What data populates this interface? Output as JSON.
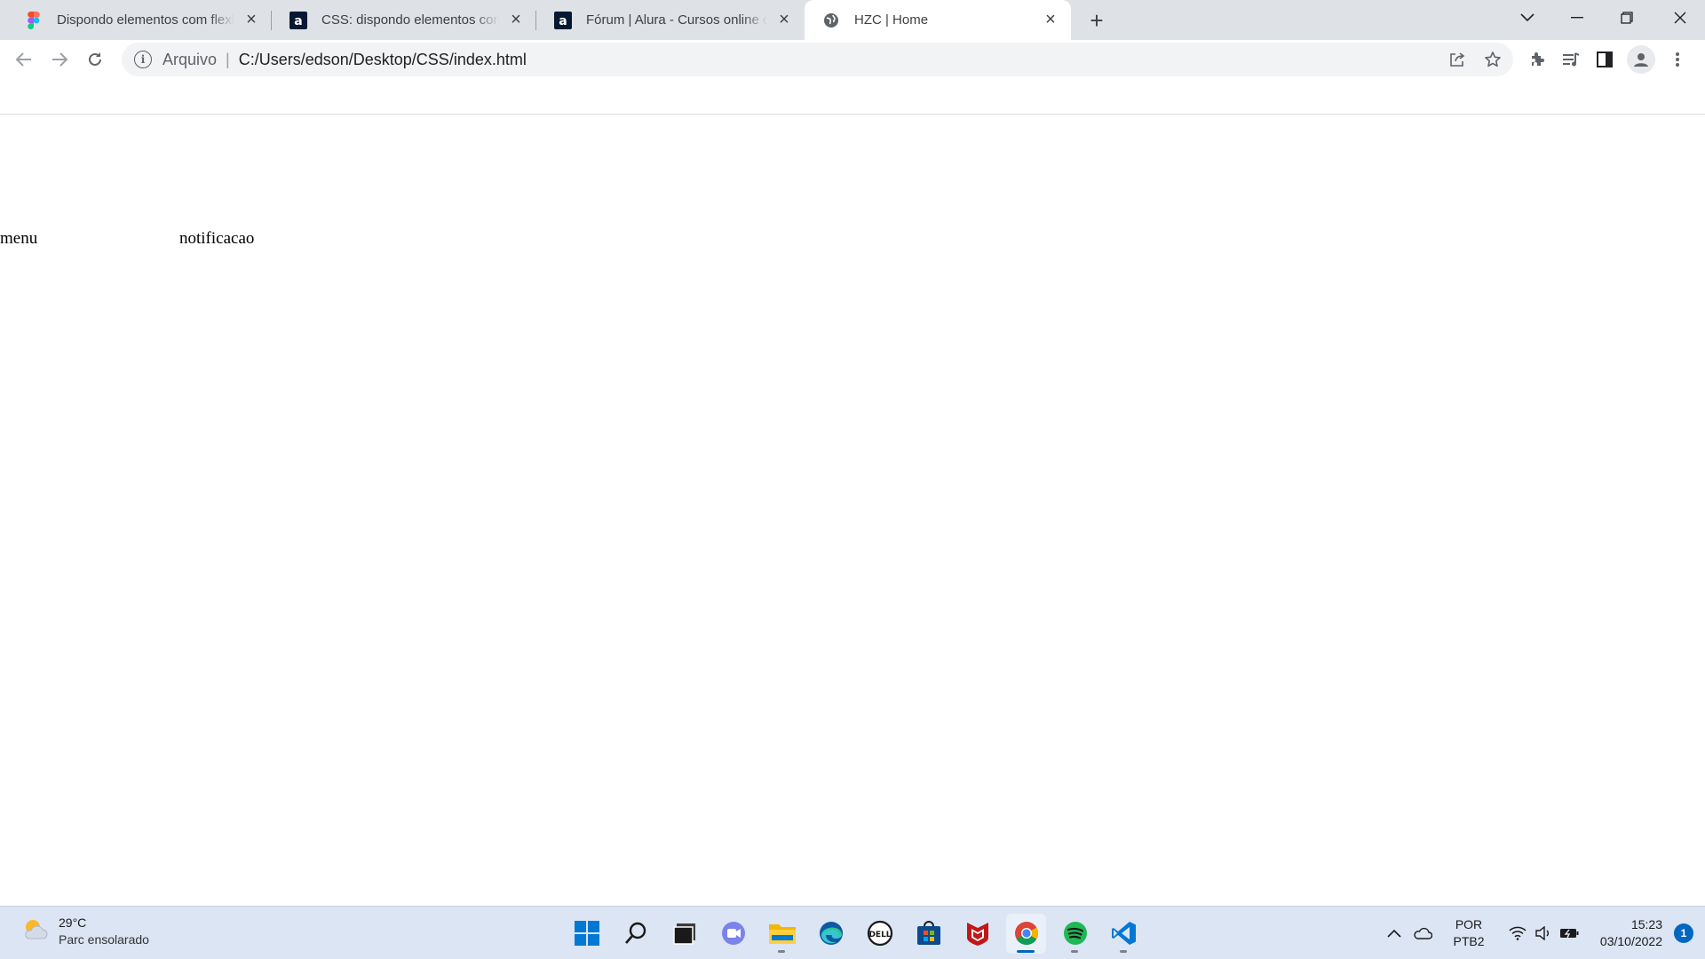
{
  "browser": {
    "tabs": [
      {
        "title": "Dispondo elementos com flexbox",
        "favicon": "figma-icon",
        "active": false
      },
      {
        "title": "CSS: dispondo elementos com Flexbox",
        "favicon": "alura-icon",
        "active": false
      },
      {
        "title": "Fórum | Alura - Cursos online de tecnologia",
        "favicon": "alura-icon",
        "active": false
      },
      {
        "title": "HZC | Home",
        "favicon": "globe-icon",
        "active": true
      }
    ],
    "address": {
      "scheme_label": "Arquivo",
      "separator": "|",
      "url": "C:/Users/edson/Desktop/CSS/index.html"
    }
  },
  "page": {
    "items": [
      "menu",
      "notificacao"
    ]
  },
  "taskbar": {
    "weather": {
      "temp": "29°C",
      "condition": "Parc ensolarado"
    },
    "apps": [
      "windows-start",
      "search",
      "task-view",
      "teams-chat",
      "file-explorer",
      "edge",
      "dell",
      "microsoft-store",
      "mcafee",
      "chrome",
      "spotify",
      "vscode"
    ],
    "tray": {
      "lang_line1": "POR",
      "lang_line2": "PTB2",
      "time": "15:23",
      "date": "03/10/2022",
      "notification_count": "1"
    }
  },
  "colors": {
    "tabstrip": "#dee1e6",
    "taskbar": "#dbe5f4",
    "accent": "#0067c0"
  }
}
